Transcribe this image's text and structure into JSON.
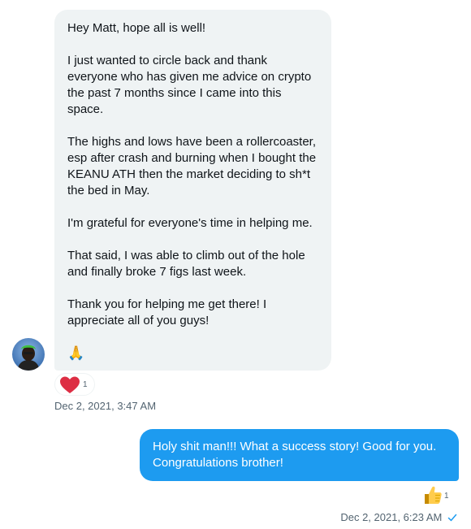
{
  "incoming": {
    "paragraphs": [
      "Hey Matt, hope all is well!",
      "I just wanted to circle back and thank everyone who has given me advice on crypto the past 7 months since I came into this space.",
      "The highs and lows have been a rollercoaster, esp after crash and burning when I bought the KEANU ATH then the market deciding to sh*t the bed in May.",
      "I'm grateful for everyone's time in helping me.",
      "That said, I was able to climb out of the hole and finally broke 7 figs last week.",
      "Thank you for helping me get there!  I appreciate all of you guys!"
    ],
    "emoji": "🙏",
    "reaction": {
      "icon": "heart-icon",
      "count": "1",
      "color": "#e0245e"
    },
    "timestamp": "Dec 2, 2021, 3:47 AM"
  },
  "outgoing": {
    "text": "Holy shit man!!! What a success story! Good for you. Congratulations brother!",
    "reaction": {
      "icon": "thumbs-up-icon",
      "count": "1"
    },
    "timestamp": "Dec 2, 2021, 6:23 AM",
    "status_icon": "seen-check-icon"
  },
  "colors": {
    "incoming_bubble": "#eff3f4",
    "outgoing_bubble": "#1d9bf0",
    "meta_text": "#536471"
  }
}
